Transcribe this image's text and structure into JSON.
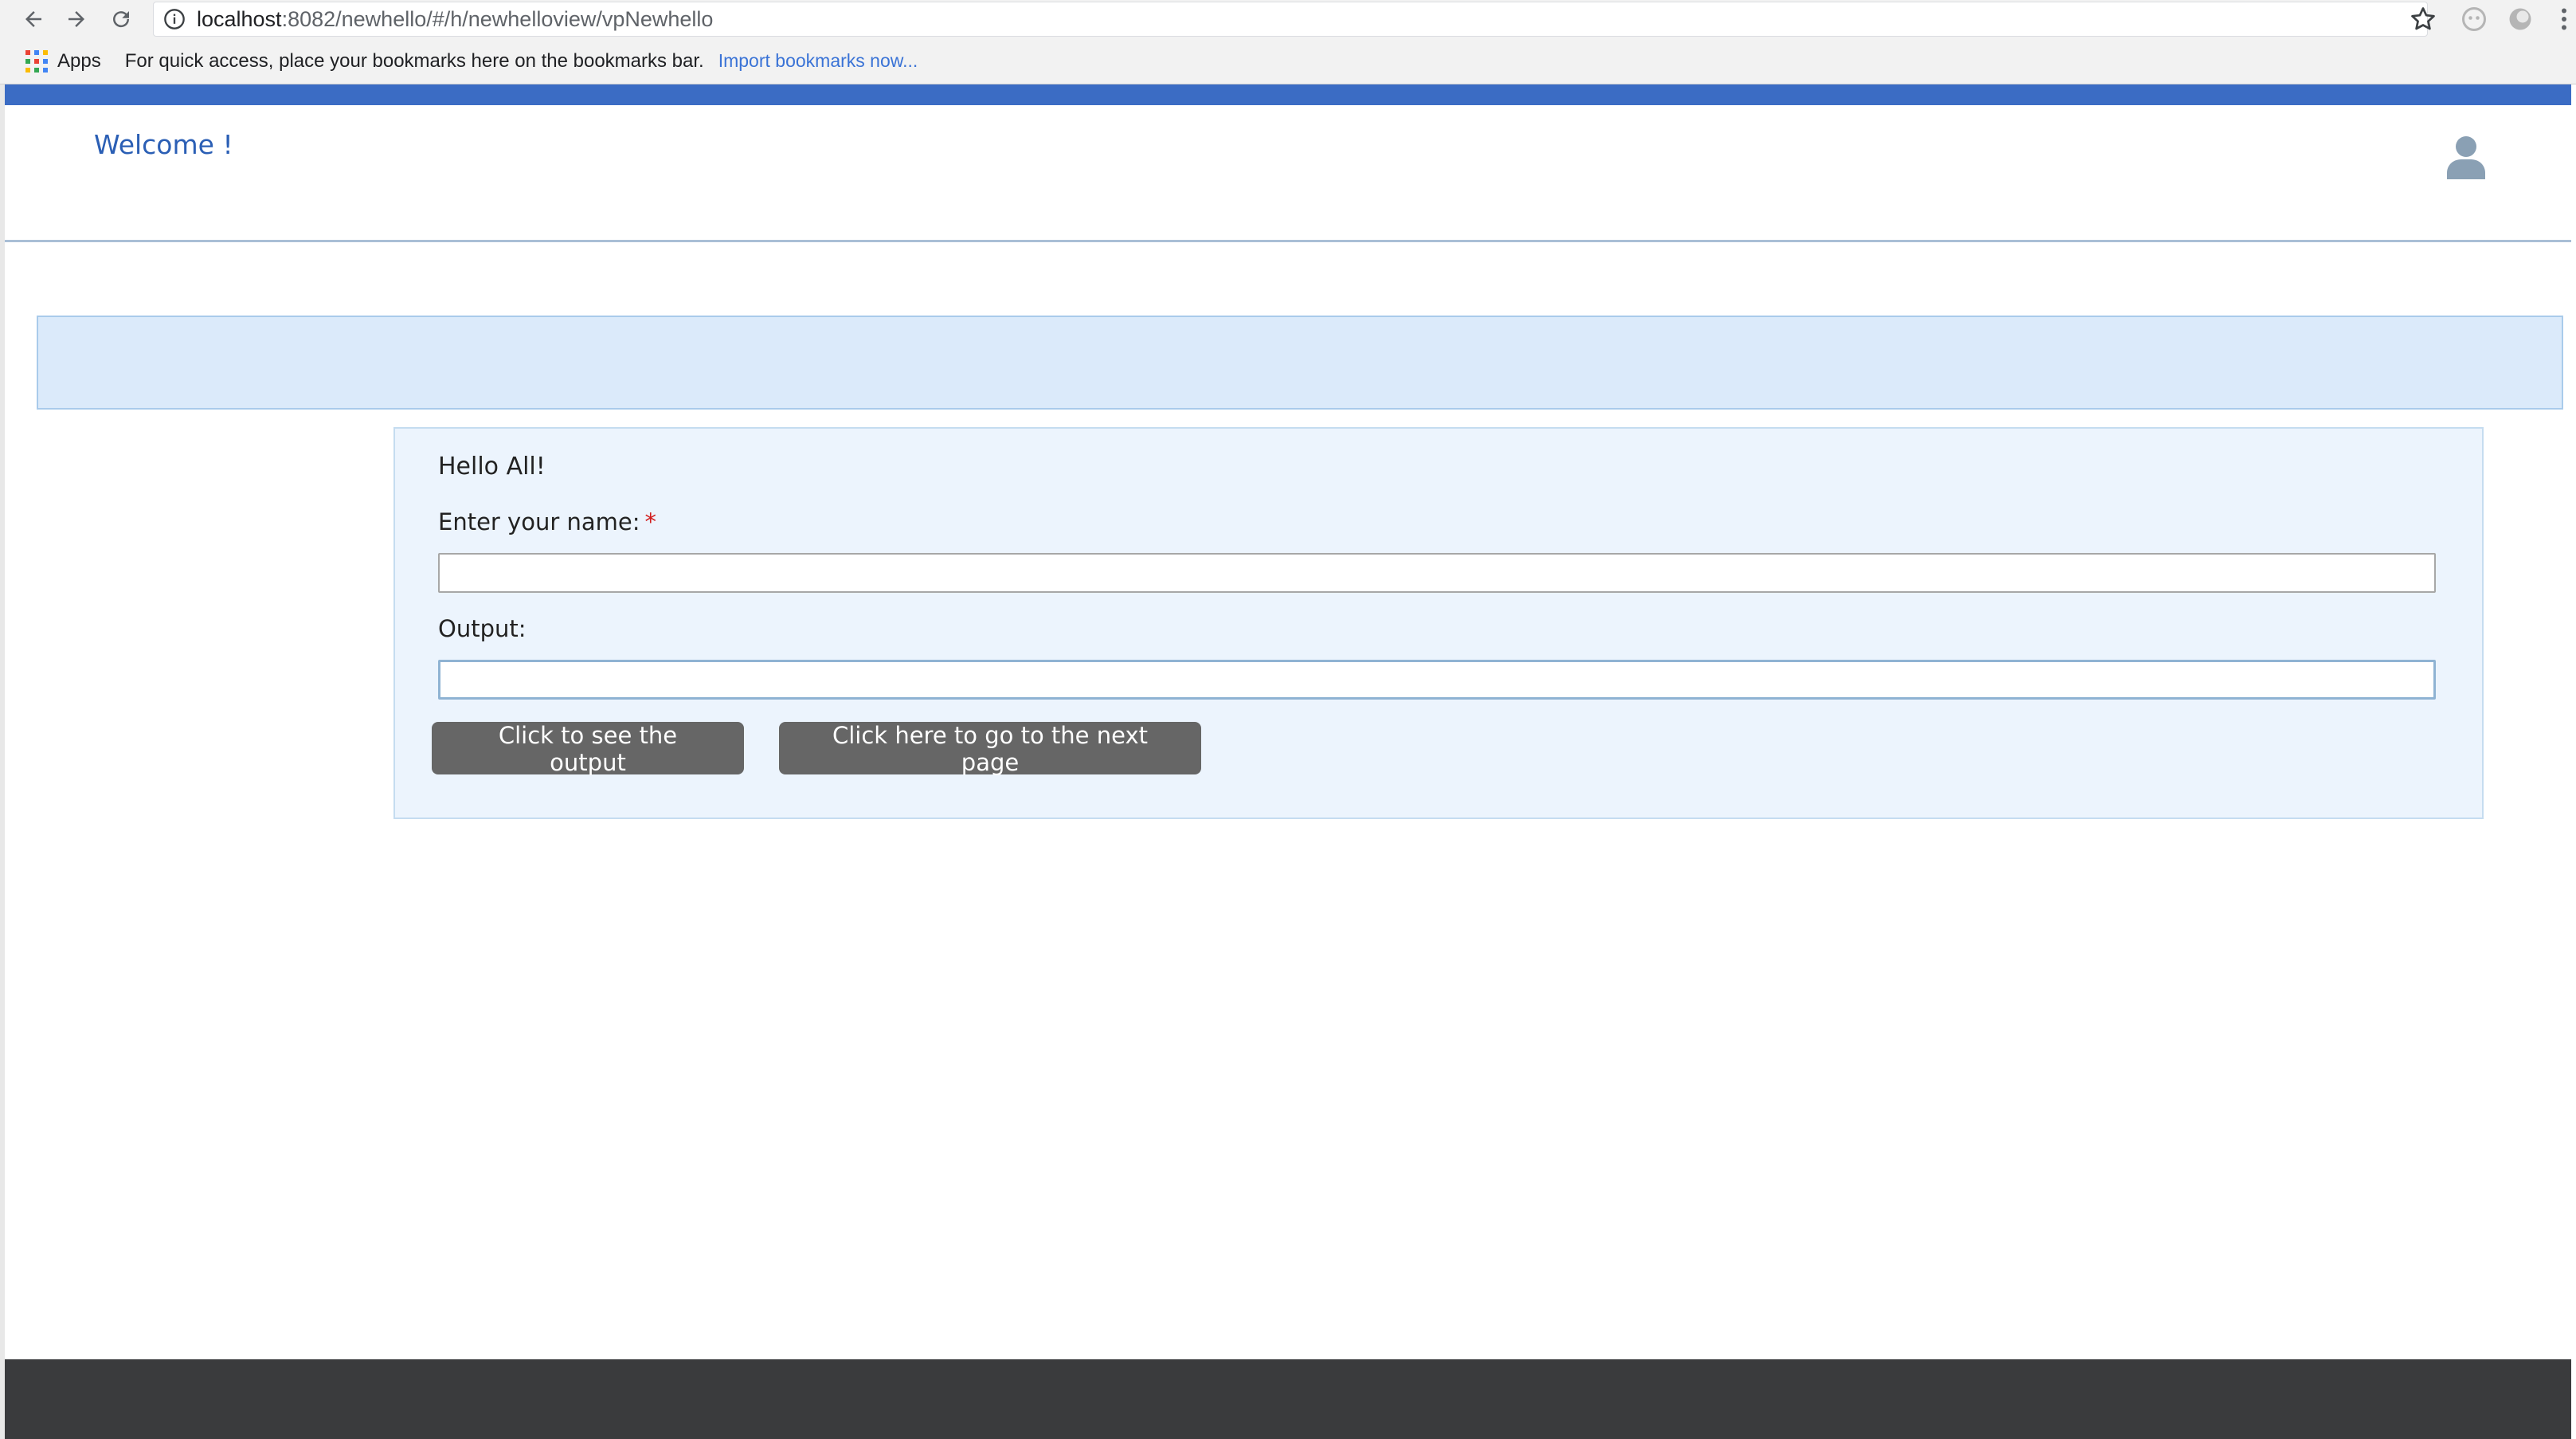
{
  "browser": {
    "url_host": "localhost",
    "url_path": ":8082/newhello/#/h/newhelloview/vpNewhello",
    "bookmarks_bar": {
      "apps_label": "Apps",
      "hint": "For quick access, place your bookmarks here on the bookmarks bar.",
      "import_link": "Import bookmarks now..."
    }
  },
  "header": {
    "welcome": "Welcome !",
    "accent_color": "#3b6cc4"
  },
  "form": {
    "greeting": "Hello All!",
    "name_label": "Enter your name:",
    "required_marker": "*",
    "name_value": "",
    "output_label": "Output:",
    "output_value": "",
    "output_button": "Click to see the output",
    "next_button": "Click here to go to the next page"
  },
  "icons": {
    "back": "arrow-left-icon",
    "forward": "arrow-right-icon",
    "reload": "reload-icon",
    "info": "info-icon",
    "bookmark": "star-icon",
    "user": "user-icon"
  }
}
